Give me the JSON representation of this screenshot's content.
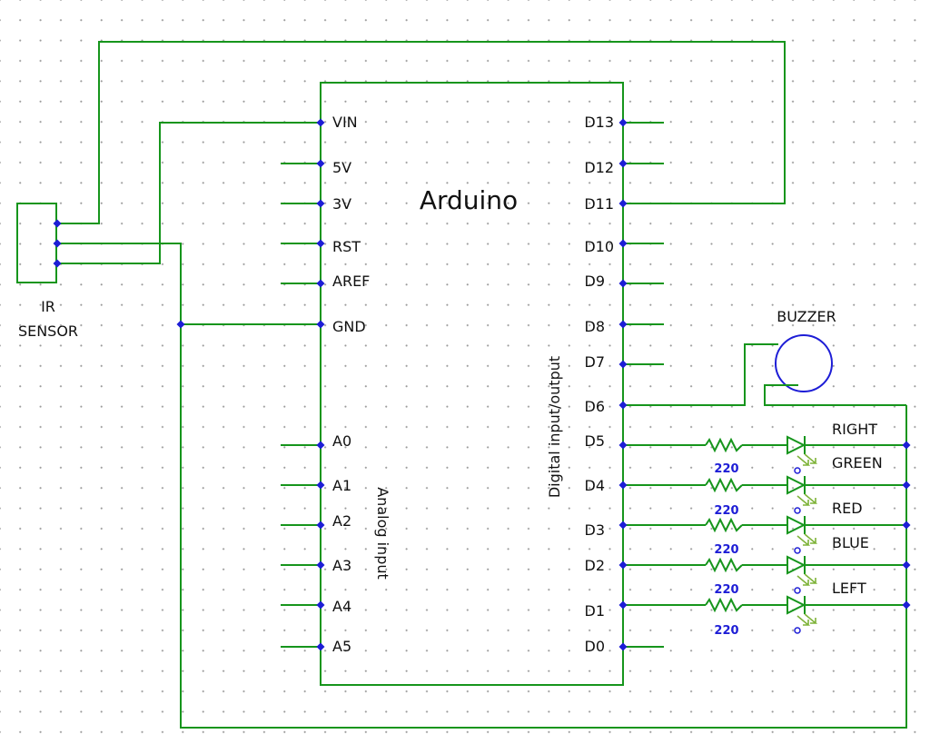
{
  "board": {
    "title": "Arduino",
    "left_pins": [
      "VIN",
      "5V",
      "3V",
      "RST",
      "AREF",
      "GND"
    ],
    "analog_pins": [
      "A0",
      "A1",
      "A2",
      "A3",
      "A4",
      "A5"
    ],
    "right_pins": [
      "D13",
      "D12",
      "D11",
      "D10",
      "D9",
      "D8",
      "D7",
      "D6",
      "D5",
      "D4",
      "D3",
      "D2",
      "D1",
      "D0"
    ],
    "analog_label": "Analog input",
    "digital_label": "Digital input/output"
  },
  "sensor": {
    "line1": "IR",
    "line2": "SENSOR"
  },
  "buzzer": {
    "label": "BUZZER"
  },
  "resistors": [
    "220",
    "220",
    "220",
    "220",
    "220"
  ],
  "leds": [
    "RIGHT",
    "GREEN",
    "RED",
    "BLUE",
    "LEFT"
  ],
  "colors": {
    "wire": "#16951c",
    "node": "#1d1dd6",
    "value": "#1d1dd6",
    "arrow": "#7fb33a"
  }
}
